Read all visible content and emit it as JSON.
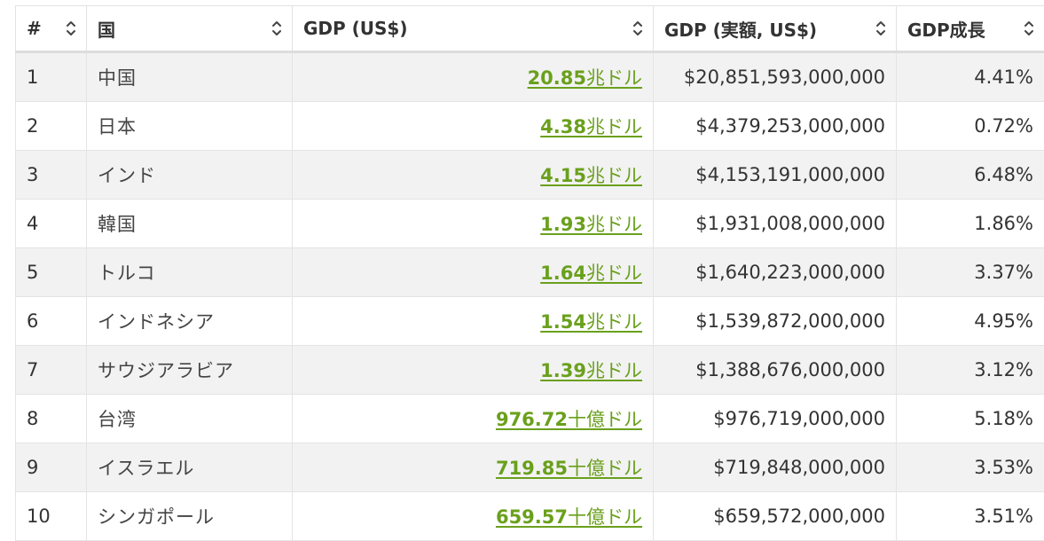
{
  "headers": [
    "#",
    "国",
    "GDP (US$)",
    "GDP (実額, US$)",
    "GDP成長"
  ],
  "rows": [
    {
      "rank": "1",
      "country": "中国",
      "gdp_num": "20.85",
      "gdp_unit": "兆ドル",
      "gdp_full": "$20,851,593,000,000",
      "growth": "4.41%"
    },
    {
      "rank": "2",
      "country": "日本",
      "gdp_num": "4.38",
      "gdp_unit": "兆ドル",
      "gdp_full": "$4,379,253,000,000",
      "growth": "0.72%"
    },
    {
      "rank": "3",
      "country": "インド",
      "gdp_num": "4.15",
      "gdp_unit": "兆ドル",
      "gdp_full": "$4,153,191,000,000",
      "growth": "6.48%"
    },
    {
      "rank": "4",
      "country": "韓国",
      "gdp_num": "1.93",
      "gdp_unit": "兆ドル",
      "gdp_full": "$1,931,008,000,000",
      "growth": "1.86%"
    },
    {
      "rank": "5",
      "country": "トルコ",
      "gdp_num": "1.64",
      "gdp_unit": "兆ドル",
      "gdp_full": "$1,640,223,000,000",
      "growth": "3.37%"
    },
    {
      "rank": "6",
      "country": "インドネシア",
      "gdp_num": "1.54",
      "gdp_unit": "兆ドル",
      "gdp_full": "$1,539,872,000,000",
      "growth": "4.95%"
    },
    {
      "rank": "7",
      "country": "サウジアラビア",
      "gdp_num": "1.39",
      "gdp_unit": "兆ドル",
      "gdp_full": "$1,388,676,000,000",
      "growth": "3.12%"
    },
    {
      "rank": "8",
      "country": "台湾",
      "gdp_num": "976.72",
      "gdp_unit": "十億ドル",
      "gdp_full": "$976,719,000,000",
      "growth": "5.18%"
    },
    {
      "rank": "9",
      "country": "イスラエル",
      "gdp_num": "719.85",
      "gdp_unit": "十億ドル",
      "gdp_full": "$719,848,000,000",
      "growth": "3.53%"
    },
    {
      "rank": "10",
      "country": "シンガポール",
      "gdp_num": "659.57",
      "gdp_unit": "十億ドル",
      "gdp_full": "$659,572,000,000",
      "growth": "3.51%"
    }
  ],
  "icons": {
    "sort": "sort-icon"
  },
  "colors": {
    "link": "#6aa01c",
    "row_alt": "#f2f2f2",
    "border": "#e4e4e4"
  }
}
